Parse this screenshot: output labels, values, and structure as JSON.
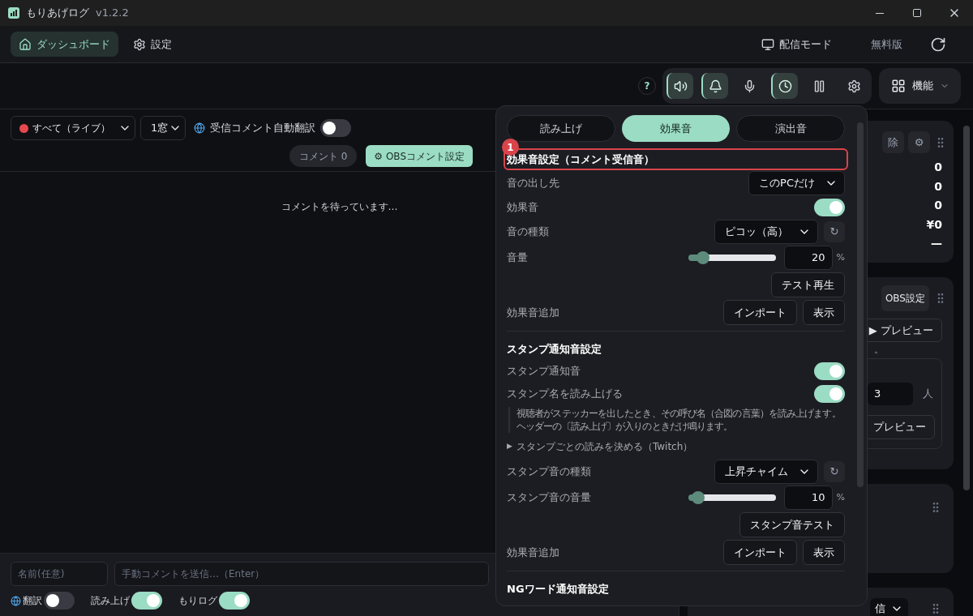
{
  "window": {
    "title": "もりあげログ",
    "version": "v1.2.2"
  },
  "nav": {
    "items": [
      {
        "label": "ダッシュボード",
        "kind": "home",
        "selected": true
      },
      {
        "label": "設定",
        "kind": "gear",
        "selected": false
      }
    ],
    "mode": "配信モード",
    "plan": "無料版"
  },
  "toolbar": {
    "help": "?",
    "tools": [
      {
        "kind": "speaker",
        "active": true
      },
      {
        "kind": "bell",
        "active": true
      },
      {
        "kind": "mic",
        "active": false
      },
      {
        "kind": "clock",
        "active": true
      },
      {
        "kind": "pause",
        "active": false
      },
      {
        "kind": "gear",
        "active": false
      }
    ],
    "features": "機能"
  },
  "comments": {
    "source": "すべて（ライブ）",
    "windows": "1窓",
    "auto_translate": {
      "label": "受信コメント自動翻訳",
      "on": false
    },
    "count": "コメント 0",
    "obs_button": "⚙ OBSコメント設定",
    "empty": "コメントを待っています…",
    "name_placeholder": "名前(任意)",
    "comment_placeholder": "手動コメントを送信…（Enter）",
    "toggles": [
      {
        "label": "翻訳",
        "kind": "translate",
        "on": false
      },
      {
        "label": "読み上げ",
        "kind": "plain",
        "on": true
      },
      {
        "label": "もりログ",
        "kind": "plain",
        "on": true
      }
    ]
  },
  "sound_panel": {
    "tabs": [
      {
        "label": "読み上げ",
        "selected": false
      },
      {
        "label": "効果音",
        "selected": true
      },
      {
        "label": "演出音",
        "selected": false
      }
    ],
    "sections": [
      {
        "title": "効果音設定（コメント受信音）",
        "annotation": "1",
        "rows": [
          {
            "kind": "select",
            "label": "音の出し先",
            "value": "このPCだけ"
          },
          {
            "kind": "toggle",
            "label": "効果音",
            "on": true
          },
          {
            "kind": "select",
            "label": "音の種類",
            "value": "ピコッ（高）",
            "reload": "↻"
          },
          {
            "kind": "slider",
            "label": "音量",
            "level": 0.15,
            "value": "20",
            "unit": "%"
          },
          {
            "kind": "button",
            "label": "テスト再生"
          },
          {
            "kind": "buttons",
            "label": "効果音追加",
            "buttons": [
              "インポート",
              "表示"
            ]
          }
        ]
      },
      {
        "title": "スタンプ通知音設定",
        "rows": [
          {
            "kind": "toggle",
            "label": "スタンプ通知音",
            "on": true
          },
          {
            "kind": "toggle",
            "label": "スタンプ名を読み上げる",
            "on": true
          },
          {
            "kind": "note",
            "lines": [
              "視聴者がステッカーを出したとき、その呼び名（合図の言葉）を読み上げます。",
              "ヘッダーの〔読み上げ〕が入りのときだけ鳴ります。"
            ]
          },
          {
            "kind": "disclosure",
            "marker": "▶",
            "label": "スタンプごとの読みを決める（Twitch）",
            "expanded": false
          },
          {
            "kind": "select",
            "label": "スタンプ音の種類",
            "value": "上昇チャイム",
            "reload": "↻"
          },
          {
            "kind": "slider",
            "label": "スタンプ音の音量",
            "level": 0.1,
            "value": "10",
            "unit": "%"
          },
          {
            "kind": "button",
            "label": "スタンプ音テスト"
          },
          {
            "kind": "buttons",
            "label": "効果音追加",
            "buttons": [
              "インポート",
              "表示"
            ]
          }
        ]
      },
      {
        "title": "NGワード通知音設定"
      }
    ]
  },
  "side_cards": [
    {
      "kind": "stats",
      "buttons": [
        "除",
        "⚙"
      ],
      "values": [
        "0",
        "0",
        "0",
        "¥0",
        "—"
      ]
    },
    {
      "kind": "obs",
      "button": "OBS設定",
      "preview": "▶ プレビュー",
      "note": "。",
      "count": "3",
      "unit": "人",
      "preview_2": "プレビュー"
    },
    {
      "kind": "empty"
    },
    {
      "kind": "select",
      "value": "信"
    }
  ]
}
